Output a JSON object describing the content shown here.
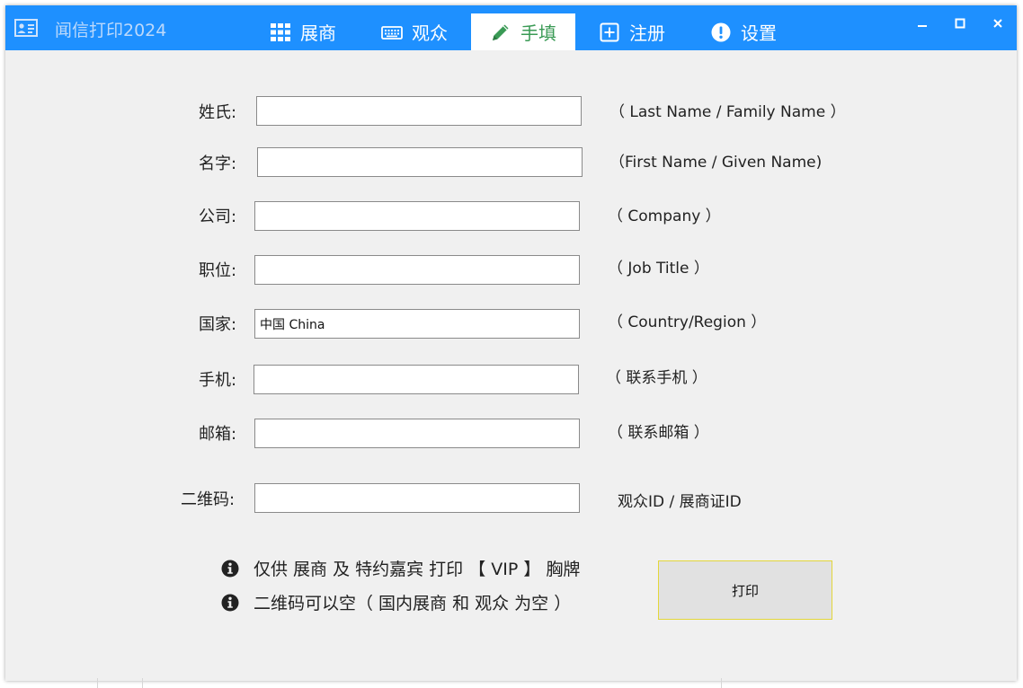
{
  "app": {
    "title": "闻信打印2024"
  },
  "tabs": [
    {
      "label": "展商",
      "icon": "grid-icon"
    },
    {
      "label": "观众",
      "icon": "keyboard-icon"
    },
    {
      "label": "手填",
      "icon": "pencil-icon",
      "active": true
    },
    {
      "label": "注册",
      "icon": "plus-square-icon"
    },
    {
      "label": "设置",
      "icon": "exclamation-circle-icon"
    }
  ],
  "colors": {
    "titlebar": "#1e90ff",
    "active_tab_text": "#3a9a55",
    "print_border": "#e3d63a"
  },
  "form": {
    "last_name": {
      "label": "姓氏:",
      "value": "",
      "hint": "（ Last Name / Family Name ）"
    },
    "first_name": {
      "label": "名字:",
      "value": "",
      "hint": "（First Name / Given Name)"
    },
    "company": {
      "label": "公司:",
      "value": "",
      "hint": "（ Company ）"
    },
    "job_title": {
      "label": "职位:",
      "value": "",
      "hint": "（ Job Title ）"
    },
    "country": {
      "label": "国家:",
      "value": "中国 China",
      "hint": "（ Country/Region ）"
    },
    "mobile": {
      "label": "手机:",
      "value": "",
      "hint": "（ 联系手机 ）"
    },
    "email": {
      "label": "邮箱:",
      "value": "",
      "hint": "（ 联系邮箱 ）"
    },
    "qrcode": {
      "label": "二维码:",
      "value": "",
      "hint": "观众ID / 展商证ID"
    }
  },
  "notes": [
    "仅供 展商 及 特约嘉宾 打印 【 VIP 】 胸牌",
    "二维码可以空（ 国内展商 和 观众 为空 ）"
  ],
  "print_button": {
    "label": "打印"
  }
}
